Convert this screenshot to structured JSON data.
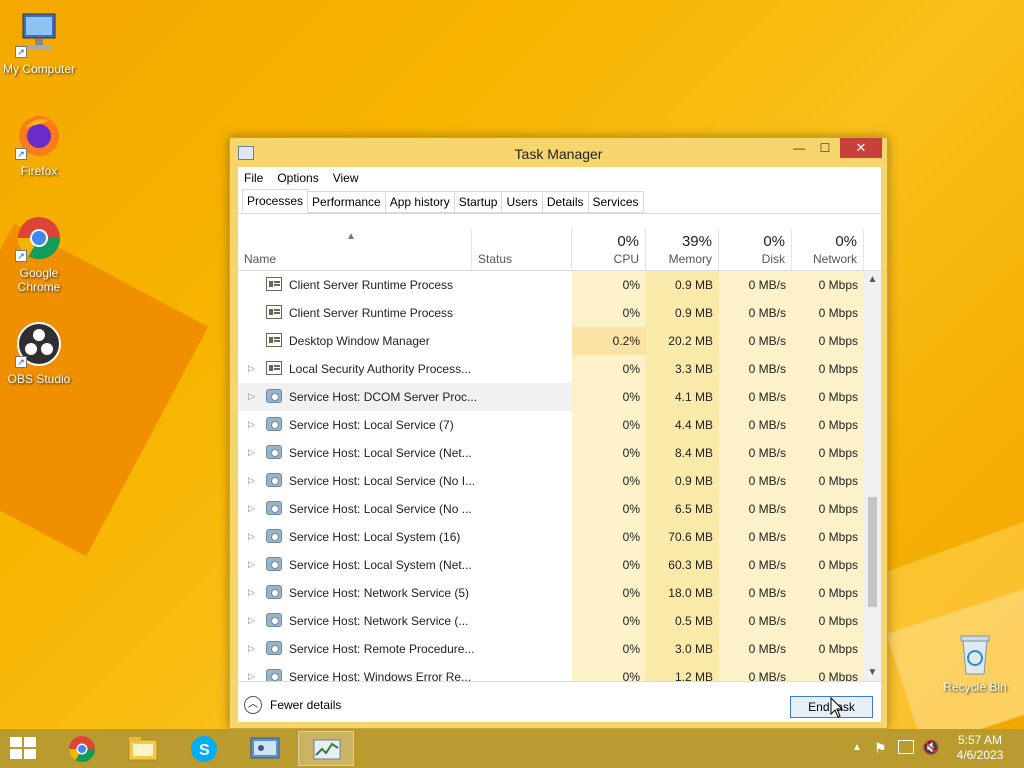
{
  "desktop": {
    "icons": [
      {
        "label": "My Computer"
      },
      {
        "label": "Firefox"
      },
      {
        "label": "Google Chrome"
      },
      {
        "label": "OBS Studio"
      },
      {
        "label": "Recycle Bin"
      }
    ]
  },
  "window": {
    "title": "Task Manager",
    "minimize": "—",
    "maximize": "☐",
    "close": "✕"
  },
  "menu": [
    "File",
    "Options",
    "View"
  ],
  "tabs": [
    "Processes",
    "Performance",
    "App history",
    "Startup",
    "Users",
    "Details",
    "Services"
  ],
  "columns": {
    "name": "Name",
    "status": "Status",
    "cpu": {
      "pct": "0%",
      "label": "CPU"
    },
    "memory": {
      "pct": "39%",
      "label": "Memory"
    },
    "disk": {
      "pct": "0%",
      "label": "Disk"
    },
    "network": {
      "pct": "0%",
      "label": "Network"
    }
  },
  "processes": [
    {
      "name": "Client Server Runtime Process",
      "cpu": "0%",
      "mem": "0.9 MB",
      "disk": "0 MB/s",
      "net": "0 Mbps"
    },
    {
      "name": "Client Server Runtime Process",
      "cpu": "0%",
      "mem": "0.9 MB",
      "disk": "0 MB/s",
      "net": "0 Mbps"
    },
    {
      "name": "Desktop Window Manager",
      "cpu": "0.2%",
      "mem": "20.2 MB",
      "disk": "0 MB/s",
      "net": "0 Mbps"
    },
    {
      "name": "Local Security Authority Process...",
      "cpu": "0%",
      "mem": "3.3 MB",
      "disk": "0 MB/s",
      "net": "0 Mbps"
    },
    {
      "name": "Service Host: DCOM Server Proc...",
      "cpu": "0%",
      "mem": "4.1 MB",
      "disk": "0 MB/s",
      "net": "0 Mbps"
    },
    {
      "name": "Service Host: Local Service (7)",
      "cpu": "0%",
      "mem": "4.4 MB",
      "disk": "0 MB/s",
      "net": "0 Mbps"
    },
    {
      "name": "Service Host: Local Service (Net...",
      "cpu": "0%",
      "mem": "8.4 MB",
      "disk": "0 MB/s",
      "net": "0 Mbps"
    },
    {
      "name": "Service Host: Local Service (No I...",
      "cpu": "0%",
      "mem": "0.9 MB",
      "disk": "0 MB/s",
      "net": "0 Mbps"
    },
    {
      "name": "Service Host: Local Service (No ...",
      "cpu": "0%",
      "mem": "6.5 MB",
      "disk": "0 MB/s",
      "net": "0 Mbps"
    },
    {
      "name": "Service Host: Local System (16)",
      "cpu": "0%",
      "mem": "70.6 MB",
      "disk": "0 MB/s",
      "net": "0 Mbps"
    },
    {
      "name": "Service Host: Local System (Net...",
      "cpu": "0%",
      "mem": "60.3 MB",
      "disk": "0 MB/s",
      "net": "0 Mbps"
    },
    {
      "name": "Service Host: Network Service (5)",
      "cpu": "0%",
      "mem": "18.0 MB",
      "disk": "0 MB/s",
      "net": "0 Mbps"
    },
    {
      "name": "Service Host: Network Service (...",
      "cpu": "0%",
      "mem": "0.5 MB",
      "disk": "0 MB/s",
      "net": "0 Mbps"
    },
    {
      "name": "Service Host: Remote Procedure...",
      "cpu": "0%",
      "mem": "3.0 MB",
      "disk": "0 MB/s",
      "net": "0 Mbps"
    },
    {
      "name": "Service Host: Windows Error Re...",
      "cpu": "0%",
      "mem": "1.2 MB",
      "disk": "0 MB/s",
      "net": "0 Mbps"
    }
  ],
  "footer": {
    "fewer_details": "Fewer details",
    "end_task": "End task"
  },
  "clock": {
    "time": "5:57 AM",
    "date": "4/6/2023"
  }
}
